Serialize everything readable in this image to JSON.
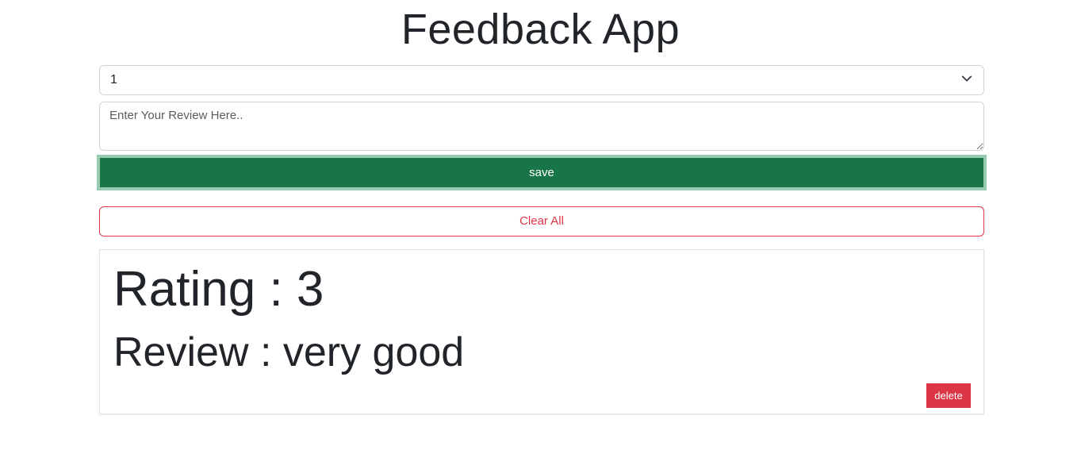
{
  "app": {
    "title": "Feedback App"
  },
  "form": {
    "rating_select": {
      "selected": "1"
    },
    "review_input": {
      "placeholder": "Enter Your Review Here..",
      "value": ""
    },
    "save_label": "save",
    "clear_all_label": "Clear All"
  },
  "feedback_list": [
    {
      "rating_text": "Rating : 3",
      "review_text": "Review : very good",
      "delete_label": "delete"
    }
  ],
  "colors": {
    "save_bg": "#177548",
    "save_focus_ring": "#98c9b1",
    "danger": "#dc3545",
    "border": "#ced4da"
  },
  "icons": {
    "select_arrow": "chevron-down-icon"
  }
}
